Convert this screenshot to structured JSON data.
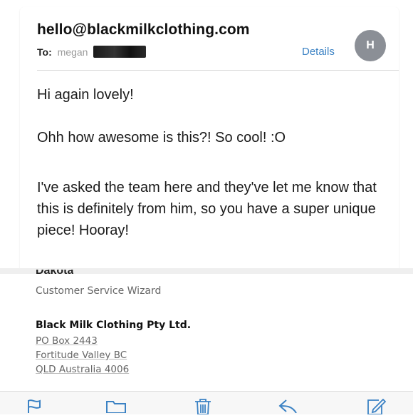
{
  "header": {
    "from": "hello@blackmilkclothing.com",
    "to_label": "To:",
    "to_name": "megan",
    "details_label": "Details",
    "avatar_initial": "H"
  },
  "message": {
    "greeting": "Hi again lovely!",
    "line2": "Ohh how awesome is this?! So cool! :O",
    "line3": "I've asked the team here and they've let me know that this is definitely from him, so you have a super unique piece! Hooray!"
  },
  "signature": {
    "name": "Dakota",
    "role": "Customer Service Wizard",
    "company": "Black Milk Clothing Pty Ltd.",
    "address_line1": "PO Box 2443",
    "address_line2": "Fortitude Valley BC",
    "address_line3": "QLD Australia 4006"
  },
  "toolbar": {
    "icons": [
      "flag-icon",
      "folder-icon",
      "trash-icon",
      "reply-icon",
      "compose-icon"
    ]
  },
  "colors": {
    "link_blue": "#3b82c4",
    "avatar_gray": "#8b8f96",
    "toolbar_blue": "#3b82c4"
  }
}
